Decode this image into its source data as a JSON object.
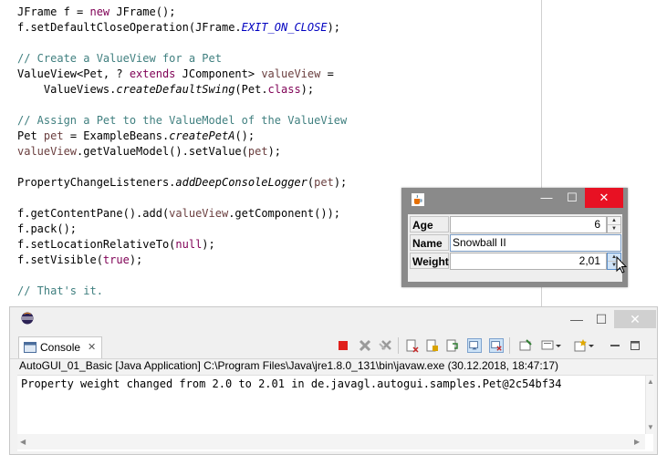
{
  "editor": {
    "lines": [
      [
        {
          "t": "JFrame f = "
        },
        {
          "t": "new",
          "c": "kw"
        },
        {
          "t": " JFrame();"
        }
      ],
      [
        {
          "t": "f.setDefaultCloseOperation(JFrame."
        },
        {
          "t": "EXIT_ON_CLOSE",
          "c": "fld"
        },
        {
          "t": ");"
        }
      ],
      [
        {
          "t": ""
        }
      ],
      [
        {
          "t": "// Create a ValueView for a Pet",
          "c": "cm"
        }
      ],
      [
        {
          "t": "ValueView<Pet, ? "
        },
        {
          "t": "extends",
          "c": "kw"
        },
        {
          "t": " JComponent> "
        },
        {
          "t": "valueView",
          "c": "var"
        },
        {
          "t": " ="
        }
      ],
      [
        {
          "t": "    ValueViews."
        },
        {
          "t": "createDefaultSwing",
          "c": "it"
        },
        {
          "t": "(Pet."
        },
        {
          "t": "class",
          "c": "kw"
        },
        {
          "t": ");"
        }
      ],
      [
        {
          "t": ""
        }
      ],
      [
        {
          "t": "// Assign a Pet to the ValueModel of the ValueView",
          "c": "cm"
        }
      ],
      [
        {
          "t": "Pet "
        },
        {
          "t": "pet",
          "c": "var"
        },
        {
          "t": " = ExampleBeans."
        },
        {
          "t": "createPetA",
          "c": "it"
        },
        {
          "t": "();"
        }
      ],
      [
        {
          "t": "valueView",
          "c": "var"
        },
        {
          "t": ".getValueModel().setValue("
        },
        {
          "t": "pet",
          "c": "var"
        },
        {
          "t": ");"
        }
      ],
      [
        {
          "t": ""
        }
      ],
      [
        {
          "t": "PropertyChangeListeners."
        },
        {
          "t": "addDeepConsoleLogger",
          "c": "it"
        },
        {
          "t": "("
        },
        {
          "t": "pet",
          "c": "var"
        },
        {
          "t": ");"
        }
      ],
      [
        {
          "t": ""
        }
      ],
      [
        {
          "t": "f.getContentPane().add("
        },
        {
          "t": "valueView",
          "c": "var"
        },
        {
          "t": ".getComponent());"
        }
      ],
      [
        {
          "t": "f.pack();"
        }
      ],
      [
        {
          "t": "f.setLocationRelativeTo("
        },
        {
          "t": "null",
          "c": "kw"
        },
        {
          "t": ");"
        }
      ],
      [
        {
          "t": "f.setVisible("
        },
        {
          "t": "true",
          "c": "kw"
        },
        {
          "t": ");"
        }
      ],
      [
        {
          "t": ""
        }
      ],
      [
        {
          "t": "// That's it.",
          "c": "cm"
        }
      ]
    ]
  },
  "frame": {
    "min_glyph": "—",
    "max_glyph": "☐",
    "close_glyph": "✕",
    "fields": {
      "age_label": "Age",
      "age_value": "6",
      "name_label": "Name",
      "name_value": "Snowball II",
      "weight_label": "Weight",
      "weight_value": "2,01"
    },
    "spin_up": "▲",
    "spin_down": "▼"
  },
  "console": {
    "min_glyph": "—",
    "max_glyph": "☐",
    "close_glyph": "✕",
    "tab_label": "Console",
    "tab_close": "✕",
    "description": "AutoGUI_01_Basic [Java Application] C:\\Program Files\\Java\\jre1.8.0_131\\bin\\javaw.exe (30.12.2018, 18:47:17)",
    "output": "Property weight changed from 2.0 to 2.01 in de.javagl.autogui.samples.Pet@2c54bf34",
    "scroll_up": "▲",
    "scroll_down": "▼",
    "scroll_left": "◀",
    "scroll_right": "▶"
  },
  "colors": {
    "keyword": "#7f0055",
    "comment": "#3f7f7f",
    "static_field": "#0000c0",
    "local_var": "#6a3e3e",
    "close_red": "#e81123"
  }
}
